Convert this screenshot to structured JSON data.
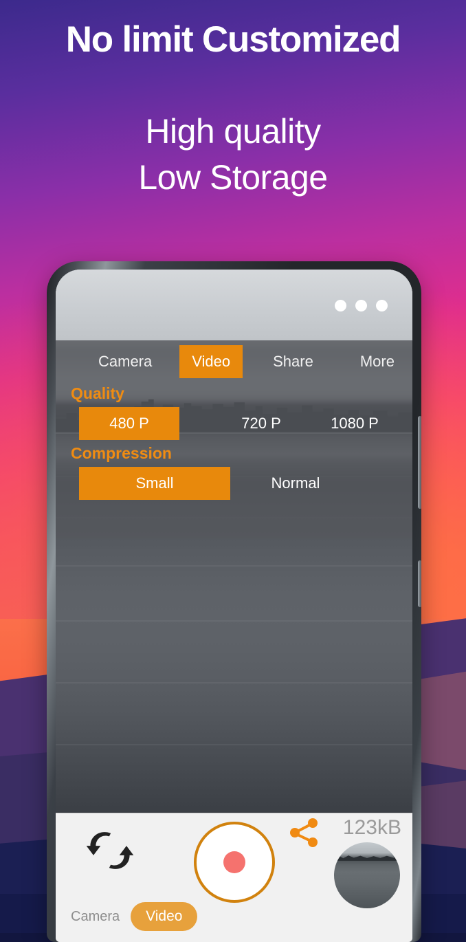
{
  "headline": {
    "main": "No limit Customized",
    "sub_line1": "High quality",
    "sub_line2": "Low Storage"
  },
  "colors": {
    "accent_orange": "#E8890C",
    "label_orange": "#F08C12",
    "pill_orange": "#E7A13C",
    "record_ring": "#D1820E",
    "record_dot": "#F5726E",
    "share_icon": "#F08A12",
    "panel_overlay": "rgba(85,88,92,0.80)",
    "control_bar_bg": "#F1F1F1",
    "size_text": "#9A9A9A"
  },
  "phone": {
    "status": {
      "overflow_menu_icon": "three-dots-icon"
    },
    "settings_panel": {
      "tabs": [
        {
          "label": "Camera",
          "active": false
        },
        {
          "label": "Video",
          "active": true
        },
        {
          "label": "Share",
          "active": false
        },
        {
          "label": "More",
          "active": false
        }
      ],
      "groups": [
        {
          "label": "Quality",
          "options": [
            {
              "label": "480 P",
              "selected": true
            },
            {
              "label": "720 P",
              "selected": false
            },
            {
              "label": "1080 P",
              "selected": false
            }
          ]
        },
        {
          "label": "Compression",
          "options": [
            {
              "label": "Small",
              "selected": true
            },
            {
              "label": "Normal",
              "selected": false
            }
          ]
        }
      ]
    },
    "control_bar": {
      "switch_camera_icon": "switch-camera-icon",
      "record_button_icon": "record-button-icon",
      "share_icon": "share-icon",
      "file_size": "123kB",
      "thumbnail_icon": "gallery-thumbnail",
      "mode_switch": {
        "camera_label": "Camera",
        "video_label": "Video",
        "active": "Video"
      }
    }
  }
}
